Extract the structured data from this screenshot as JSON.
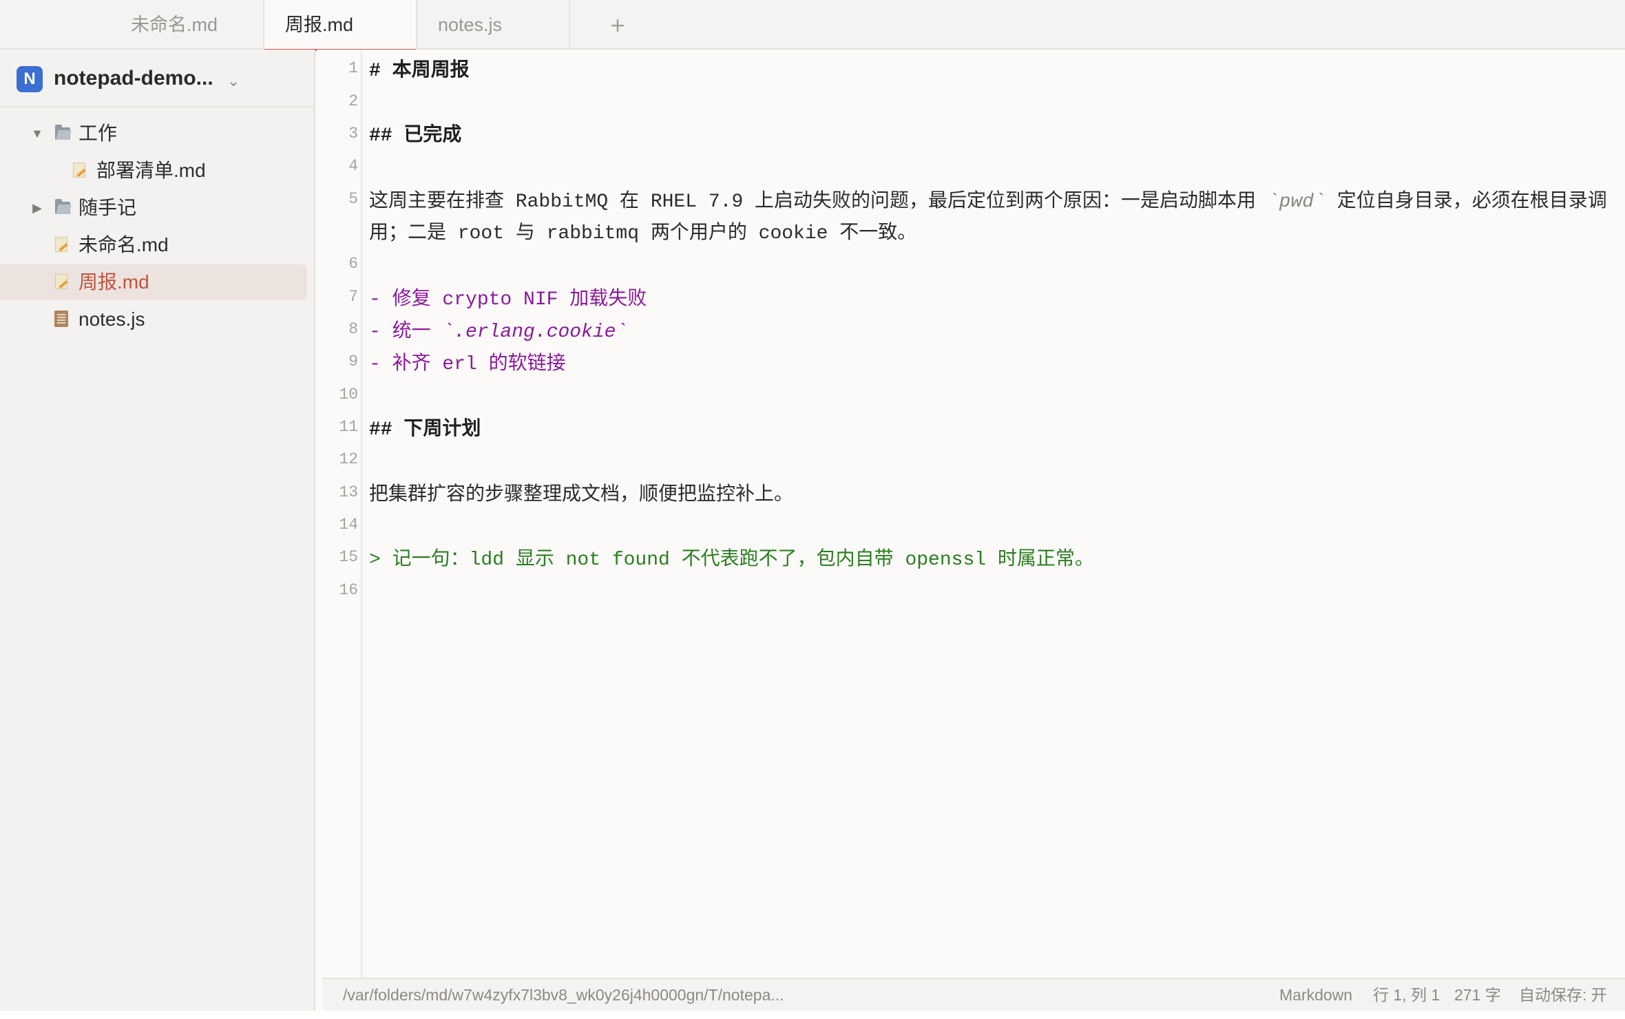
{
  "tabs": [
    {
      "label": "未命名.md",
      "active": false
    },
    {
      "label": "周报.md",
      "active": true
    },
    {
      "label": "notes.js",
      "active": false
    }
  ],
  "tab_add_label": "+",
  "workspace": {
    "badge": "N",
    "name": "notepad-demo...",
    "chevron": "⌄"
  },
  "tree": {
    "folder_work": {
      "label": "工作",
      "caret": "▼"
    },
    "file_deploy": {
      "label": "部署清单.md"
    },
    "folder_notes": {
      "label": "随手记",
      "caret": "▶"
    },
    "file_untitled": {
      "label": "未命名.md"
    },
    "file_weekly": {
      "label": "周报.md"
    },
    "file_notesjs": {
      "label": "notes.js"
    }
  },
  "editor": {
    "line_numbers": [
      "1",
      "2",
      "3",
      "4",
      "5",
      "6",
      "7",
      "8",
      "9",
      "10",
      "11",
      "12",
      "13",
      "14",
      "15",
      "16"
    ],
    "lines": {
      "l1": "# 本周周报",
      "l3": "## 已完成",
      "l5_a": "这周主要在排查 RabbitMQ 在 RHEL 7.9 上启动失败的问题，最后定位到两个原因：一是启动脚本用 ",
      "l5_code": "`pwd`",
      "l5_b": " 定位自身目录，必须在根目录调",
      "l5_wrap": "用；二是 root 与 rabbitmq 两个用户的 cookie 不一致。",
      "l7": "- 修复 crypto NIF 加载失败",
      "l8_a": "- 统一 ",
      "l8_code": "`.erlang.cookie`",
      "l9": "- 补齐 erl 的软链接",
      "l11": "## 下周计划",
      "l13": "把集群扩容的步骤整理成文档，顺便把监控补上。",
      "l15": "> 记一句：ldd 显示 not found 不代表跑不了，包内自带 openssl 时属正常。"
    }
  },
  "status": {
    "path": "/var/folders/md/w7w4zyfx7l3bv8_wk0y26j4h0000gn/T/notepa...",
    "language": "Markdown",
    "position": "行 1, 列 1",
    "char_count": "271 字",
    "autosave": "自动保存: 开"
  },
  "colors": {
    "accent": "#c9594a",
    "workspace_badge": "#3b6fd1",
    "list_text": "#8a1a9b",
    "quote_text": "#2b7d1f"
  }
}
